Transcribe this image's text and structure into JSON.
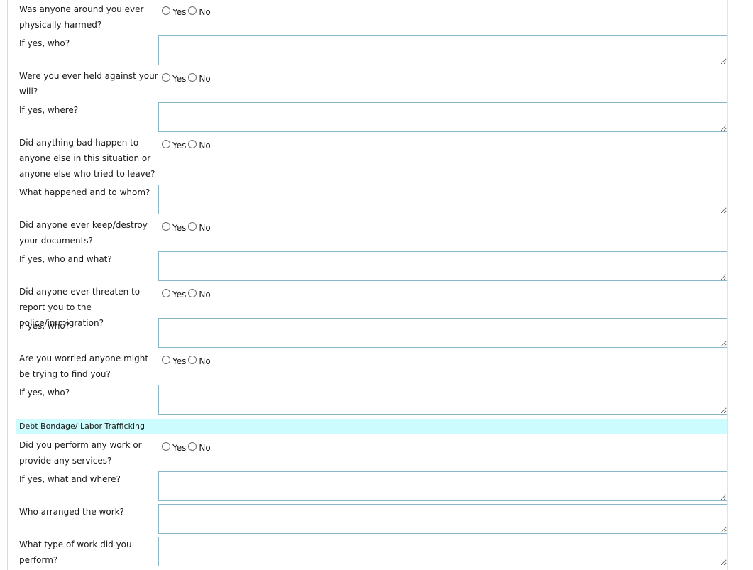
{
  "options": {
    "yes": "Yes",
    "no": "No"
  },
  "questions": [
    {
      "q": "Was anyone around you ever physically harmed?",
      "followup": "If yes, who?"
    },
    {
      "q": "Were you ever held against your will?",
      "followup": "If yes, where?"
    },
    {
      "q": "Did anything bad happen to anyone else in this situation or anyone else who tried to leave?",
      "followup": "What happened and to whom?"
    },
    {
      "q": "Did anyone ever keep/destroy your documents?",
      "followup": "If yes, who and what?"
    },
    {
      "q": "Did anyone ever threaten to report you to the police/immigration?",
      "followup": "If yes, who?"
    },
    {
      "q": "Are you worried anyone might be trying to find you?",
      "followup": "If yes, who?"
    }
  ],
  "section": {
    "title": "Debt Bondage/ Labor Trafficking"
  },
  "labor": {
    "q1": "Did you perform any work or provide any services?",
    "q1_followup": "If yes, what and where?",
    "q2": "Who arranged the work?",
    "q3": "What type of work did you perform?"
  }
}
